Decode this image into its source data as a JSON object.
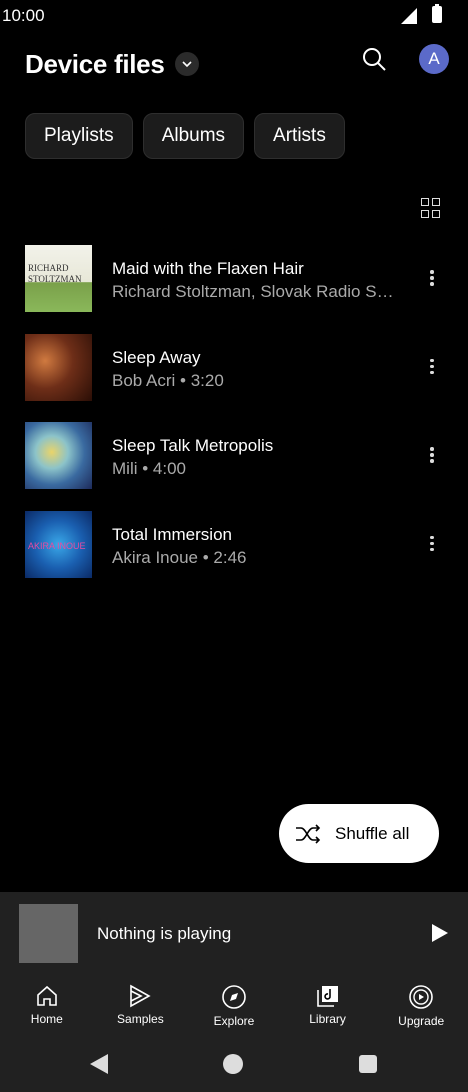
{
  "status_bar": {
    "time": "10:00"
  },
  "header": {
    "title": "Device files",
    "avatar_letter": "A"
  },
  "chips": [
    {
      "label": "Playlists"
    },
    {
      "label": "Albums"
    },
    {
      "label": "Artists"
    }
  ],
  "tracks": [
    {
      "title": "Maid with the Flaxen Hair",
      "subtitle": "Richard Stoltzman, Slovak Radio Symphony Orchestra"
    },
    {
      "title": "Sleep Away",
      "subtitle": "Bob Acri • 3:20"
    },
    {
      "title": "Sleep Talk Metropolis",
      "subtitle": "Mili • 4:00"
    },
    {
      "title": "Total Immersion",
      "subtitle": "Akira Inoue • 2:46"
    }
  ],
  "shuffle": {
    "label": "Shuffle all"
  },
  "mini_player": {
    "text": "Nothing is playing"
  },
  "bottom_nav": [
    {
      "label": "Home",
      "icon": "home-icon"
    },
    {
      "label": "Samples",
      "icon": "samples-icon"
    },
    {
      "label": "Explore",
      "icon": "explore-icon"
    },
    {
      "label": "Library",
      "icon": "library-icon"
    },
    {
      "label": "Upgrade",
      "icon": "upgrade-icon"
    }
  ]
}
